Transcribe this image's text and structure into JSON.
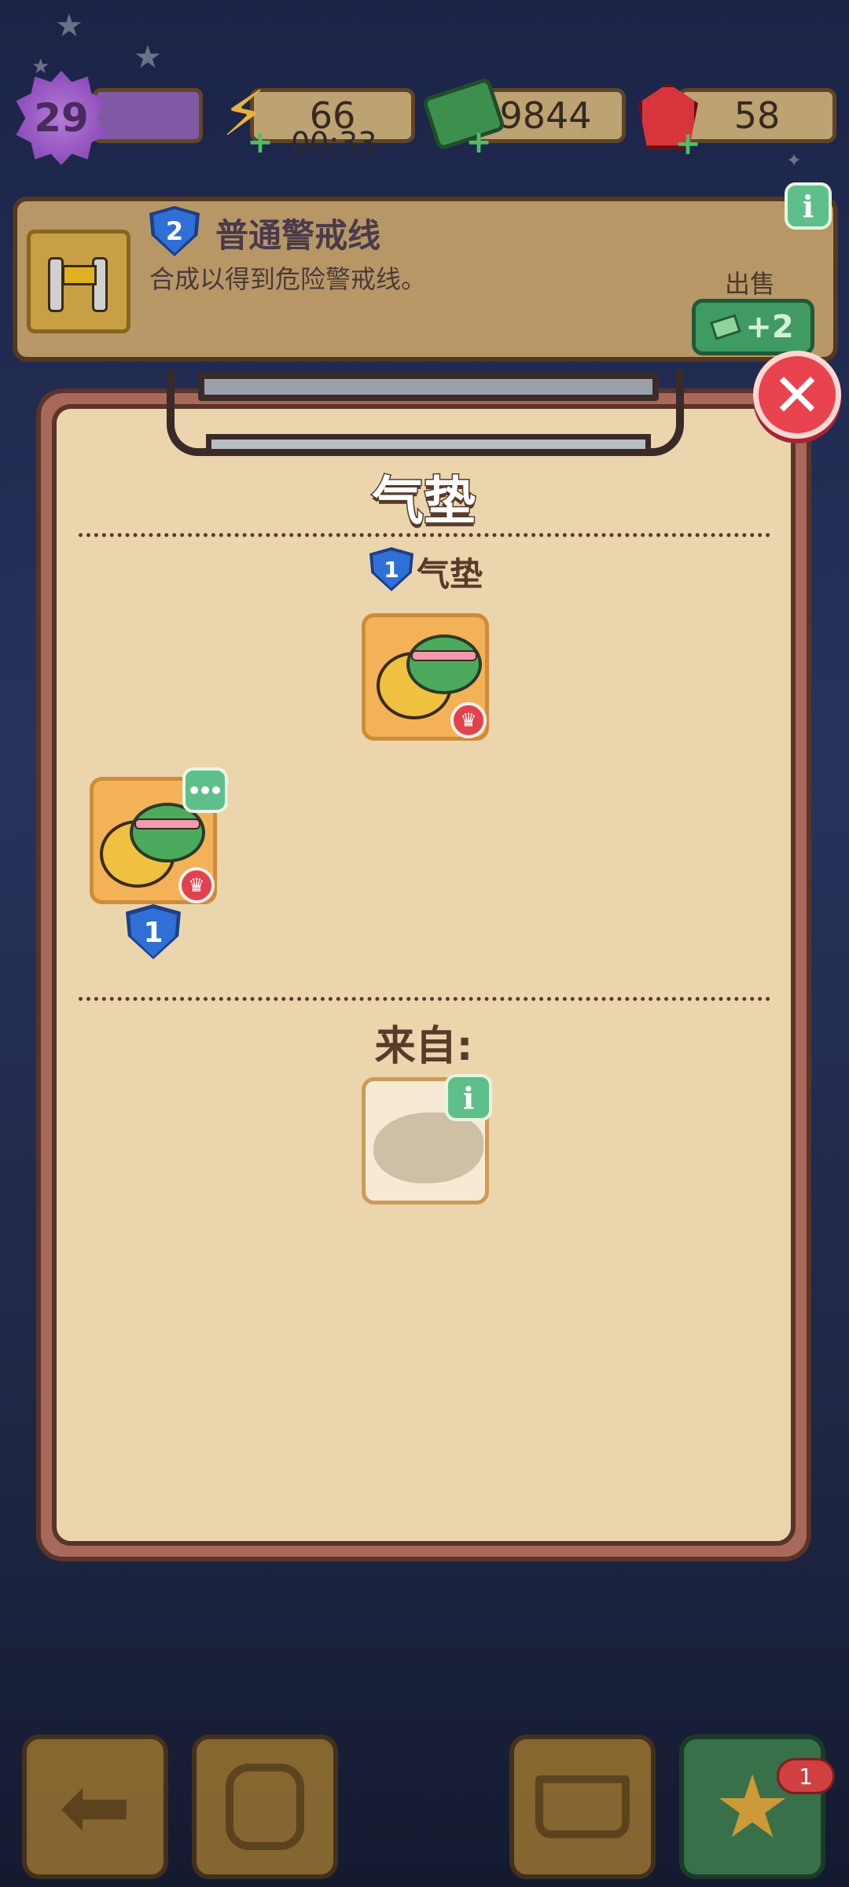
{
  "hud": {
    "level": "29",
    "energy": "66",
    "energy_timer": "00:33",
    "cash": "9844",
    "gems": "58"
  },
  "banner": {
    "tier": "2",
    "item_name": "普通警戒线",
    "description": "合成以得到危险警戒线。",
    "sell_label": "出售",
    "sell_value": "+2"
  },
  "panel": {
    "title": "气垫",
    "chain_tier": "1",
    "chain_item_name": "气垫",
    "variant_tier": "1",
    "from_label": "来自:"
  },
  "bottom_bar": {
    "notification_count": "1"
  },
  "colors": {
    "close_button": "#e8434e",
    "info_button": "#5fbf8a",
    "tier_shield": "#2f6fd6",
    "panel_paper": "#ead5ad"
  },
  "icons": {
    "close": "close-icon",
    "info": "info-icon",
    "crown": "crown-icon",
    "more": "more-dots-icon"
  }
}
